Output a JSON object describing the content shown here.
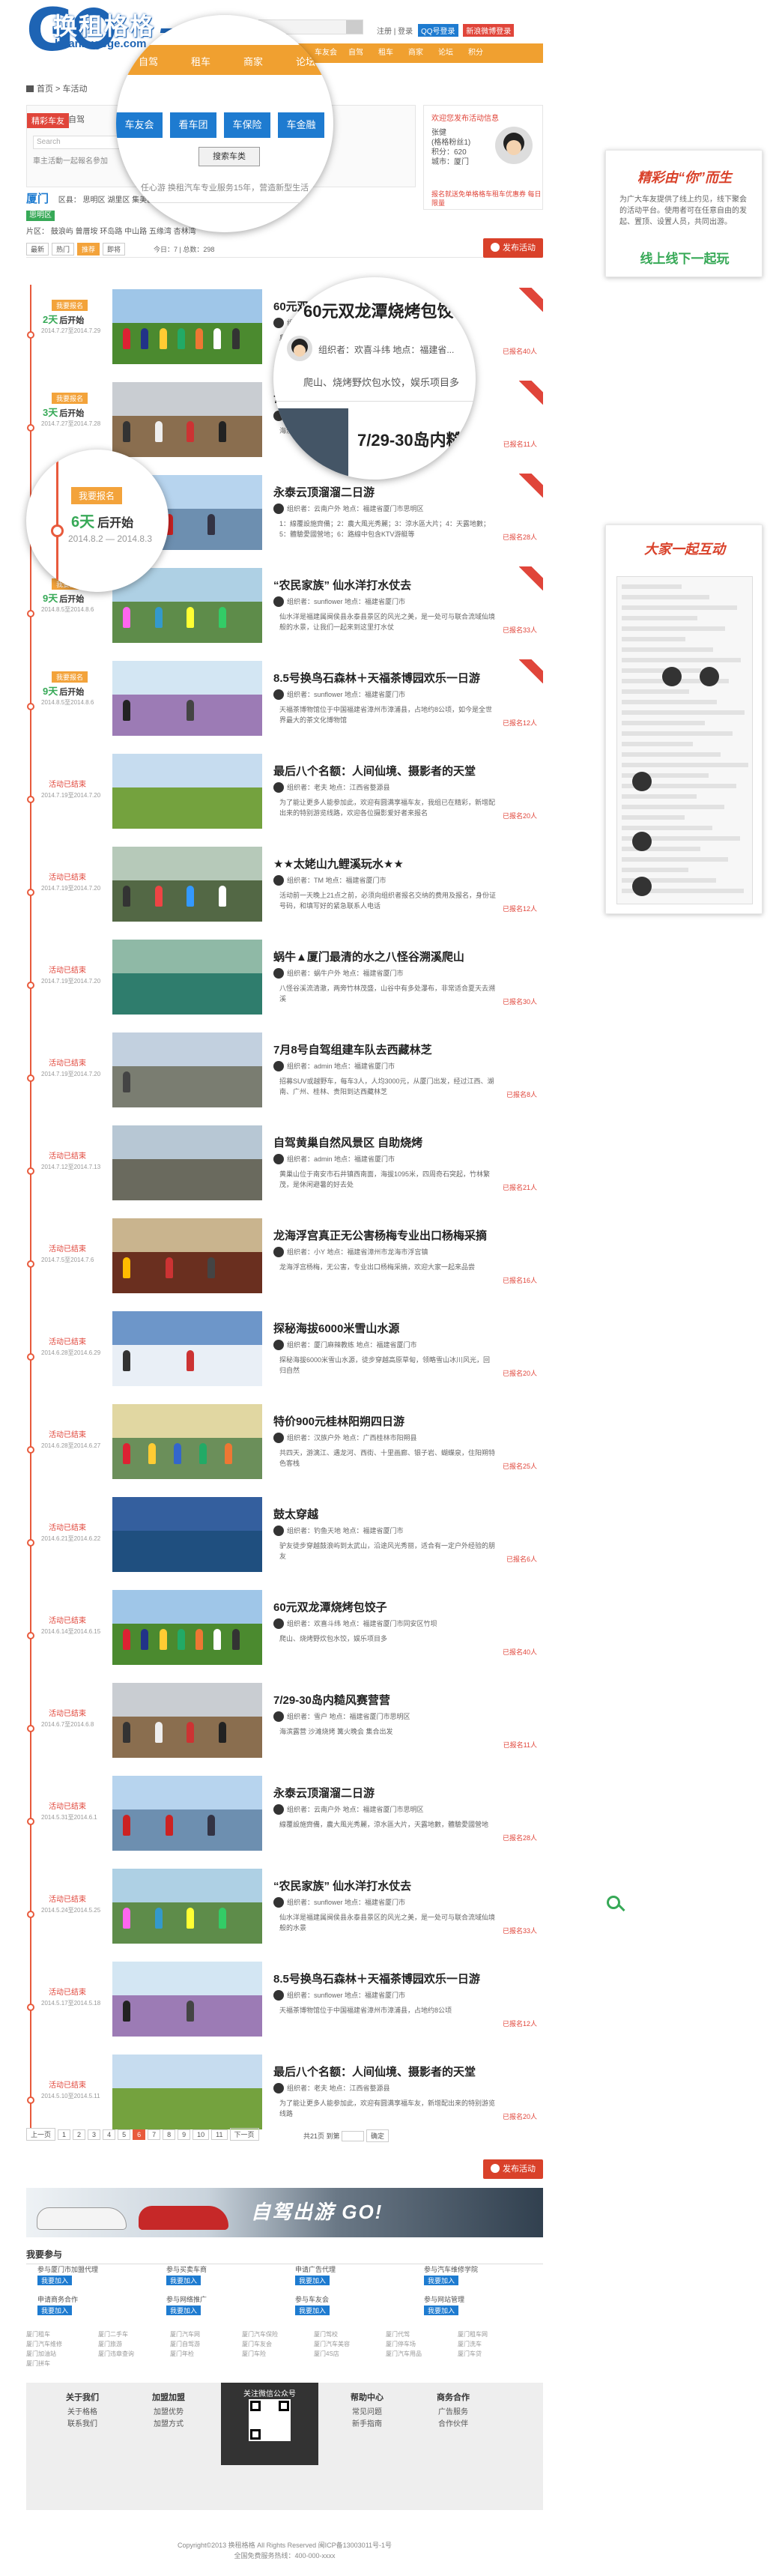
{
  "site": {
    "logo_cn": "换租格格",
    "logo_en": "huanzugege.com",
    "logo_num": "7"
  },
  "toplinks": {
    "login": "注册 | 登录",
    "qq": "QQ号登录",
    "weibo": "新浪微博登录"
  },
  "nav": [
    "首页",
    "活动",
    "出游",
    "车友会",
    "自驾",
    "租车",
    "商家",
    "论坛",
    "积分"
  ],
  "breadcrumb": "首页 > 车活动",
  "search": {
    "tab_active": "精彩车友",
    "tab_other": "自驾",
    "placeholder": "Search",
    "hint": "車主活動一起報名參加",
    "zoom_categories": [
      "车友会",
      "看车团",
      "车保险",
      "车金融"
    ],
    "zoom_button": "搜索车类",
    "zoom_hint": "任心游    换租汽车专业服务15年，营造新型生活"
  },
  "user": {
    "note": "欢迎您发布活动信息",
    "name": "张健",
    "level": "(格格粉丝1)",
    "points": "积分：620",
    "city": "城市：厦门",
    "note2": "报名就送免单格格车租车优惠券 每日限量"
  },
  "filters": {
    "area_label": "厦门",
    "area_row": "区县：  思明区  湖里区  集美区  海沧区  翔安区  同安区",
    "area_selected": "思明区",
    "tags_row": "片区：  鼓浪屿  曾厝垵  环岛路  中山路  五缘湾  杏林湾"
  },
  "sort": {
    "options": [
      "最新",
      "热门",
      "推荐",
      "即将"
    ],
    "active_index": 2,
    "count": "今日：7 | 总数：298"
  },
  "publish_label": "发布活动",
  "zoom_item": {
    "title": "60元双龙潭烧烤包饺子",
    "meta": "组织者：欢喜斗纬    地点：福建省...",
    "desc": "爬山、烧烤野炊包水饺，娱乐项目多",
    "title2": "7/29-30岛内糙风赛"
  },
  "zoom_badge": {
    "label": "我要报名",
    "days": "6天",
    "suffix": "后开始",
    "dates": "2014.8.2 — 2014.8.3"
  },
  "events": [
    {
      "status": "open",
      "badge": "我要报名",
      "days": "2天",
      "suffix": "后开始",
      "dates": "2014.7.27至2014.7.29",
      "title": "60元双龙潭烧烤包饺子",
      "meta": "组织者：欢喜斗纬    地点：福建省厦门市同安区竹坝",
      "desc": "爬山、烧烤野炊包水饺，娱乐项目多，适合全家参加",
      "join": "已报名40人",
      "scene": 0
    },
    {
      "status": "open",
      "badge": "我要报名",
      "days": "3天",
      "suffix": "后开始",
      "dates": "2014.7.27至2014.7.28",
      "title": "7/29-30岛内糙风赛营营",
      "meta": "组织者：雪户    地点：福建省厦门市思明区",
      "desc": "海滨露营 沙滩烧烤 篝火晚会 集合出发",
      "join": "已报名11人",
      "scene": 1
    },
    {
      "status": "open",
      "badge": "我要报名",
      "days": "6天",
      "suffix": "后开始",
      "dates": "2014.8.2至2014.8.3",
      "title": "永泰云顶溜溜二日游",
      "meta": "组织者：云南户外    地点：福建省厦门市思明区",
      "desc": "1：線覆設施齊備；2：農大風光秀麗；3：涼水區大片；4：天露地數；5：體驗愛國營地；6：路線中包含KTV游艇等",
      "join": "已报名28人",
      "scene": 2
    },
    {
      "status": "open",
      "badge": "我要报名",
      "days": "9天",
      "suffix": "后开始",
      "dates": "2014.8.5至2014.8.6",
      "title": "“农民家族” 仙水洋打水仗去",
      "meta": "组织者：sunflower    地点：福建省厦门市",
      "desc": "仙水洋是福建属闽侯县永泰县景区的风光之美，是一处可与联合流域仙境般的水景，让我们一起来到这里打水仗",
      "join": "已报名33人",
      "scene": 3
    },
    {
      "status": "open",
      "badge": "我要报名",
      "days": "9天",
      "suffix": "后开始",
      "dates": "2014.8.5至2014.8.6",
      "title": "8.5号换鸟石森林＋天福茶博园欢乐一日游",
      "meta": "组织者：sunflower    地点：福建省厦门市",
      "desc": "天福茶博物馆位于中国福建省漳州市漳浦县，占地约8公顷，如今是全世界最大的茶文化博物馆",
      "join": "已报名12人",
      "scene": 4
    },
    {
      "status": "ended",
      "ended": "活动已结束",
      "dates": "2014.7.19至2014.7.20",
      "title": "最后八个名额：人间仙境、摄影者的天堂",
      "meta": "组织者：老夫    地点：江西省婺源县",
      "desc": "为了能让更多人能参加此，欢迎有圆满享福车友，我组已在精彩，新增配出来的特别游览线路，欢迎各位摄影爱好者来报名",
      "join": "已报名20人",
      "scene": 5
    },
    {
      "status": "ended",
      "ended": "活动已结束",
      "dates": "2014.7.19至2014.7.20",
      "title": "★★太姥山九鲤溪玩水★★",
      "meta": "组织者：TM    地点：福建省厦门市",
      "desc": "活动前一天晚上21点之前，必须向组织者报名交纳的费用及报名，身份证号码，和填写好的紧急联系人电话",
      "join": "已报名12人",
      "scene": 6
    },
    {
      "status": "ended",
      "ended": "活动已结束",
      "dates": "2014.7.19至2014.7.20",
      "title": "蜗牛▲厦门最清的水之八怪谷溯溪爬山",
      "meta": "组织者：蜗牛户外    地点：福建省厦门市",
      "desc": "八怪谷溪流清澈，两旁竹林茂盛，山谷中有多处瀑布，非常适合夏天去溯溪",
      "join": "已报名30人",
      "scene": 7
    },
    {
      "status": "ended",
      "ended": "活动已结束",
      "dates": "2014.7.19至2014.7.20",
      "title": "7月8号自驾组建车队去西藏林芝",
      "meta": "组织者：admin    地点：福建省厦门市",
      "desc": "招募SUV或越野车，每车3人，人均3000元，从厦门出发，经过江西、湖南、广州、桂林、贵阳到达西藏林芝",
      "join": "已报名8人",
      "scene": 8
    },
    {
      "status": "ended",
      "ended": "活动已结束",
      "dates": "2014.7.12至2014.7.13",
      "title": "自驾黄巢自然风景区 自助烧烤",
      "meta": "组织者：admin    地点：福建省厦门市",
      "desc": "黄巢山位于南安市石井镇西南面，海拔1095米，四周奇石突起，竹林繁茂，是休闲避暑的好去处",
      "join": "已报名21人",
      "scene": 9
    },
    {
      "status": "ended",
      "ended": "活动已结束",
      "dates": "2014.7.5至2014.7.6",
      "title": "龙海浮宫真正无公害杨梅专业出口杨梅采摘",
      "meta": "组织者：小Y    地点：福建省漳州市龙海市浮宫镇",
      "desc": "龙海浮宫杨梅，无公害，专业出口杨梅采摘，欢迎大家一起来品尝",
      "join": "已报名16人",
      "scene": 10
    },
    {
      "status": "ended",
      "ended": "活动已结束",
      "dates": "2014.6.28至2014.6.29",
      "title": "探秘海拔6000米雪山水源",
      "meta": "组织者：厦门麻辣教练    地点：福建省厦门市",
      "desc": "探秘海拔6000米雪山水源，徒步穿越高原草甸，领略雪山冰川风光，回归自然",
      "join": "已报名20人",
      "scene": 11
    },
    {
      "status": "ended",
      "ended": "活动已结束",
      "dates": "2014.6.28至2014.6.27",
      "title": "特价900元桂林阳朔四日游",
      "meta": "组织者：汉族户外    地点：广西桂林市阳朔县",
      "desc": "共四天，游漓江、遇龙河、西街、十里画廊、银子岩、蝴蝶泉，住阳朔特色客栈",
      "join": "已报名25人",
      "scene": 12
    },
    {
      "status": "ended",
      "ended": "活动已结束",
      "dates": "2014.6.21至2014.6.22",
      "title": "鼓太穿越",
      "meta": "组织者：钓鱼天地    地点：福建省厦门市",
      "desc": "驴友徒步穿越鼓浪屿到太武山，沿途风光秀丽，适合有一定户外经验的朋友",
      "join": "已报名6人",
      "scene": 13
    },
    {
      "status": "ended",
      "ended": "活动已结束",
      "dates": "2014.6.14至2014.6.15",
      "title": "60元双龙潭烧烤包饺子",
      "meta": "组织者：欢喜斗纬    地点：福建省厦门市同安区竹坝",
      "desc": "爬山、烧烤野炊包水饺，娱乐项目多",
      "join": "已报名40人",
      "scene": 0
    },
    {
      "status": "ended",
      "ended": "活动已结束",
      "dates": "2014.6.7至2014.6.8",
      "title": "7/29-30岛内糙风赛营营",
      "meta": "组织者：雪户    地点：福建省厦门市思明区",
      "desc": "海滨露营 沙滩烧烤 篝火晚会 集合出发",
      "join": "已报名11人",
      "scene": 1
    },
    {
      "status": "ended",
      "ended": "活动已结束",
      "dates": "2014.5.31至2014.6.1",
      "title": "永泰云顶溜溜二日游",
      "meta": "组织者：云南户外    地点：福建省厦门市思明区",
      "desc": "線覆設施齊備，農大風光秀麗，涼水區大片，天露地數，體驗愛國營地",
      "join": "已报名28人",
      "scene": 2
    },
    {
      "status": "ended",
      "ended": "活动已结束",
      "dates": "2014.5.24至2014.5.25",
      "title": "“农民家族” 仙水洋打水仗去",
      "meta": "组织者：sunflower    地点：福建省厦门市",
      "desc": "仙水洋是福建属闽侯县永泰县景区的风光之美，是一处可与联合流域仙境般的水景",
      "join": "已报名33人",
      "scene": 3
    },
    {
      "status": "ended",
      "ended": "活动已结束",
      "dates": "2014.5.17至2014.5.18",
      "title": "8.5号换鸟石森林＋天福茶博园欢乐一日游",
      "meta": "组织者：sunflower    地点：福建省厦门市",
      "desc": "天福茶博物馆位于中国福建省漳州市漳浦县，占地约8公顷",
      "join": "已报名12人",
      "scene": 4
    },
    {
      "status": "ended",
      "ended": "活动已结束",
      "dates": "2014.5.10至2014.5.11",
      "title": "最后八个名额：人间仙境、摄影者的天堂",
      "meta": "组织者：老夫    地点：江西省婺源县",
      "desc": "为了能让更多人能参加此，欢迎有圆满享福车友，新增配出来的特别游览线路",
      "join": "已报名20人",
      "scene": 5
    }
  ],
  "pager": {
    "prev": "上一页",
    "pages": [
      "1",
      "2",
      "3",
      "4",
      "5",
      "6",
      "7",
      "8",
      "9",
      "10",
      "11"
    ],
    "active_index": 5,
    "next": "下一页",
    "total": "共21页   到第",
    "go": "确定"
  },
  "banner_text": "自驾出游 GO!",
  "participate": {
    "title": "我要参与",
    "cols": [
      {
        "label": "参与厦门市加盟代理",
        "btn": "我要加入"
      },
      {
        "label": "参与买卖车商",
        "btn": "我要加入"
      },
      {
        "label": "申请广告代理",
        "btn": "我要加入"
      },
      {
        "label": "参与汽车维修学院",
        "btn": "我要加入"
      },
      {
        "label": "申请商务合作",
        "btn": "我要加入"
      },
      {
        "label": "参与网络推广",
        "btn": "我要加入"
      },
      {
        "label": "参与车友会",
        "btn": "我要加入"
      },
      {
        "label": "参与网站管理",
        "btn": "我要加入"
      }
    ]
  },
  "links": [
    "厦门租车",
    "厦门二手车",
    "厦门汽车网",
    "厦门汽车保险",
    "厦门驾校",
    "厦门代驾",
    "厦门租车网",
    "厦门汽车维修",
    "厦门旅游",
    "厦门自驾游",
    "厦门车友会",
    "厦门汽车美容",
    "厦门停车场",
    "厦门洗车",
    "厦门加油站",
    "厦门违章查询",
    "厦门年检",
    "厦门车险",
    "厦门4S店",
    "厦门汽车用品",
    "厦门车贷",
    "厦门拼车"
  ],
  "footer": {
    "cols": [
      {
        "title": "关于我们",
        "items": [
          "关于格格",
          "联系我们"
        ]
      },
      {
        "title": "加盟加盟",
        "items": [
          "加盟优势",
          "加盟方式"
        ]
      },
      {
        "title": "帮助中心",
        "items": [
          "常见问题",
          "新手指南"
        ]
      },
      {
        "title": "商务合作",
        "items": [
          "广告服务",
          "合作伙伴"
        ]
      }
    ],
    "qr_title": "关注微信公众号",
    "copyright": "Copyright©2013 换租格格 All Rights Reserved 闽ICP备13003011号-1号",
    "copyright2": "全国免费服务热线：400-000-xxxx"
  },
  "cards": {
    "card1_title": "精彩由“你”而生",
    "card1_text": "为广大车友提供了线上约见，线下聚会的活动平台。使用者可在任意自由的发起、置顶、设置人员，共同出游。",
    "card1_slogan": "线上线下一起玩",
    "card2_title": "大家一起互动"
  },
  "colors": {
    "accent": "#e85a3c",
    "brand": "#1e64b4",
    "nav": "#f0a030",
    "green": "#37a957"
  }
}
